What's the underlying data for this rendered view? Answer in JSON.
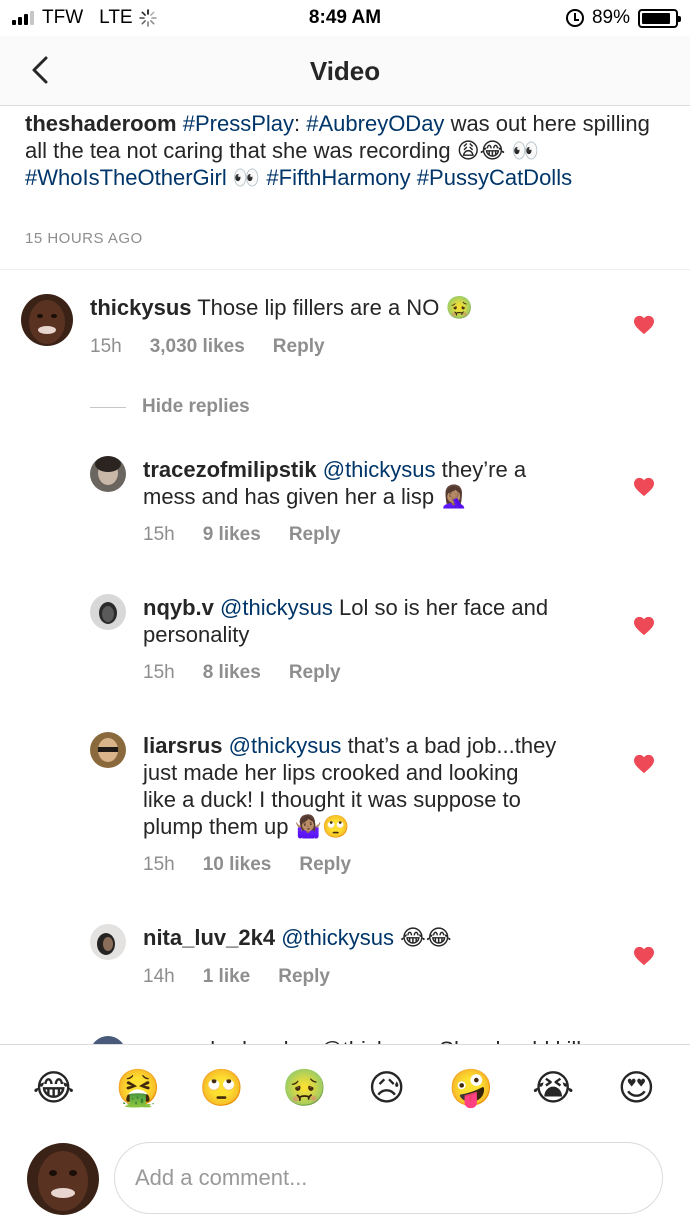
{
  "status_bar": {
    "carrier": "TFW",
    "network": "LTE",
    "time": "8:49 AM",
    "battery_percent": "89%",
    "battery_level": 0.89
  },
  "nav": {
    "title": "Video",
    "back_icon": "chevron-left-icon"
  },
  "caption": {
    "username": "theshaderoom",
    "tag1": "#PressPlay",
    "sep": ":",
    "tag2": "#AubreyODay",
    "text": "was out here spilling all the tea not caring that she was recording",
    "emoji1": "😩😂",
    "emoji2": "👀",
    "tag3": "#WhoIsTheOtherGirl",
    "emoji3": "👀",
    "tag4": "#FifthHarmony",
    "tag5": "#PussyCatDolls",
    "time": "15 HOURS AGO"
  },
  "main_comment": {
    "username": "thickysus",
    "text": "Those lip fillers are a NO",
    "emoji": "🤢",
    "time": "15h",
    "likes": "3,030 likes",
    "reply": "Reply"
  },
  "hide_replies": "Hide replies",
  "replies": [
    {
      "username": "tracezofmilipstik",
      "mention": "@thickysus",
      "text1": "they’re a",
      "text2": "mess and has given her a lisp",
      "emoji": "🤦🏽‍♀️",
      "time": "15h",
      "likes": "9 likes",
      "reply": "Reply"
    },
    {
      "username": "nqyb.v",
      "mention": "@thickysus",
      "text1": "Lol so is her face and",
      "text2": "personality",
      "time": "15h",
      "likes": "8 likes",
      "reply": "Reply"
    },
    {
      "username": "liarsrus",
      "mention": "@thickysus",
      "text1": "that’s a bad job...they",
      "text2": "just made her lips crooked and looking",
      "text3": "like a duck! I thought it was suppose to",
      "text4": "plump them up",
      "emoji": "🤷🏽‍♀️🙄",
      "time": "15h",
      "likes": "10 likes",
      "reply": "Reply"
    },
    {
      "username": "nita_luv_2k4",
      "mention": "@thickysus",
      "emoji": "😂😂",
      "time": "14h",
      "likes": "1 like",
      "reply": "Reply"
    }
  ],
  "cutoff_text": "__maabadnnahm @thickysus She should kill",
  "emoji_bar": [
    "😂",
    "🤮",
    "🙄",
    "🤢",
    "😥",
    "🤪",
    "😭",
    "😍"
  ],
  "comment_input": {
    "placeholder": "Add a comment..."
  },
  "colors": {
    "heart": "#ed4956",
    "link": "#003569",
    "muted": "#8e8e8e"
  }
}
